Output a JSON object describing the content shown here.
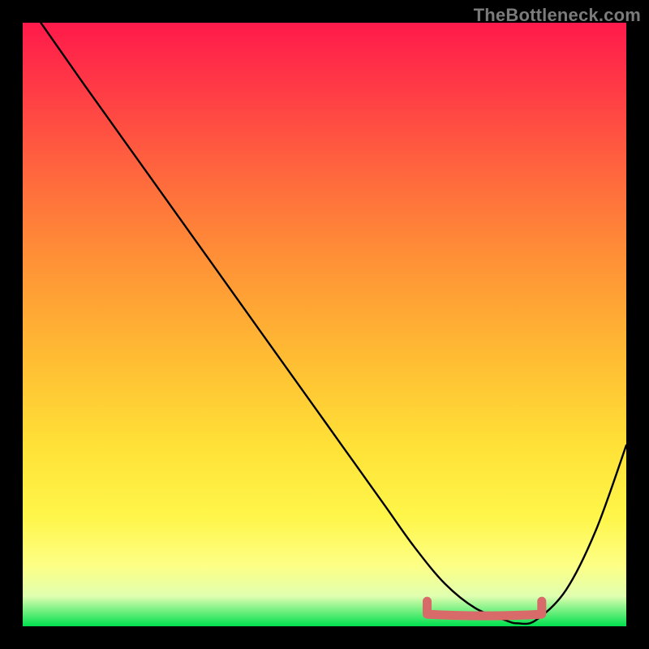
{
  "watermark": "TheBottleneck.com",
  "chart_data": {
    "type": "line",
    "title": "",
    "xlabel": "",
    "ylabel": "",
    "xlim": [
      0,
      100
    ],
    "ylim": [
      0,
      100
    ],
    "grid": false,
    "legend": false,
    "series": [
      {
        "name": "bottleneck-curve",
        "color": "#000000",
        "x": [
          3,
          10,
          20,
          30,
          40,
          50,
          55,
          60,
          65,
          70,
          75,
          80,
          82,
          85,
          90,
          95,
          100
        ],
        "values": [
          100,
          90,
          76,
          62,
          48,
          34,
          27,
          20,
          13,
          7,
          3,
          1,
          0.5,
          1,
          6,
          16,
          30
        ]
      }
    ],
    "optimal_range": {
      "x_start": 67,
      "x_end": 86,
      "color": "#d96a6a",
      "baseline_y": 2
    },
    "background_gradient": {
      "orientation": "vertical",
      "stops": [
        {
          "pos": 0.0,
          "color": "#ff1a4b"
        },
        {
          "pos": 0.12,
          "color": "#ff3e45"
        },
        {
          "pos": 0.26,
          "color": "#ff6a3d"
        },
        {
          "pos": 0.4,
          "color": "#ff9336"
        },
        {
          "pos": 0.55,
          "color": "#ffbb33"
        },
        {
          "pos": 0.7,
          "color": "#ffe137"
        },
        {
          "pos": 0.82,
          "color": "#fff64a"
        },
        {
          "pos": 0.9,
          "color": "#fdff86"
        },
        {
          "pos": 0.95,
          "color": "#e0ffb0"
        },
        {
          "pos": 1.0,
          "color": "#00e04e"
        }
      ]
    }
  }
}
